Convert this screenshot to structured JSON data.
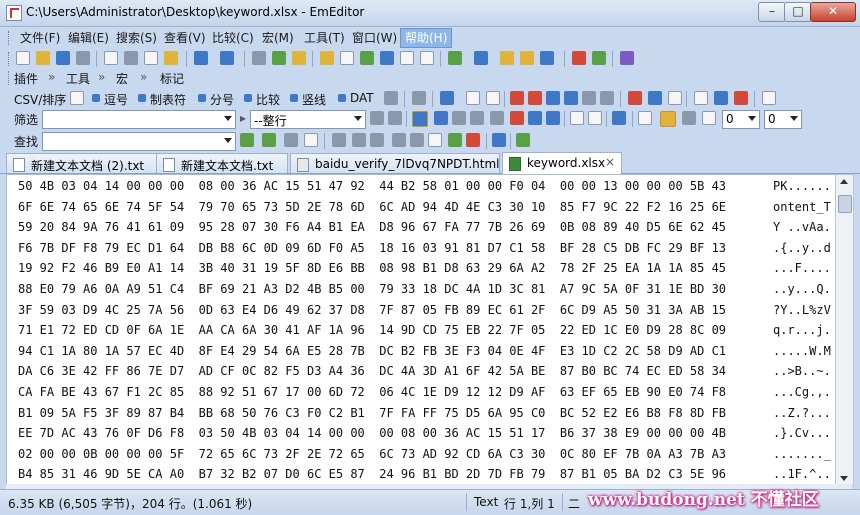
{
  "window": {
    "title": "C:\\Users\\Administrator\\Desktop\\keyword.xlsx - EmEditor"
  },
  "menu": [
    {
      "label": "文件(F)"
    },
    {
      "label": "编辑(E)"
    },
    {
      "label": "搜索(S)"
    },
    {
      "label": "查看(V)"
    },
    {
      "label": "比较(C)"
    },
    {
      "label": "宏(M)"
    },
    {
      "label": "工具(T)"
    },
    {
      "label": "窗口(W)"
    },
    {
      "label": "帮助(H)"
    }
  ],
  "toolbar3": {
    "plugins": "插件",
    "tools": "工具",
    "macro": "宏",
    "markers": "标记"
  },
  "toolbar4": {
    "csv": "CSV/排序",
    "comma": "逗号",
    "tab": "制表符",
    "semicolon": "分号",
    "compare": "比较",
    "pipe": "竖线",
    "dat": "DAT"
  },
  "toolbar5": {
    "filter_label": "筛选",
    "filter_mode": "--整行",
    "combo_a": "0",
    "combo_b": "0"
  },
  "toolbar6": {
    "find_label": "查找"
  },
  "tabs": [
    {
      "label": "新建文本文档 (2).txt"
    },
    {
      "label": "新建文本文档.txt"
    },
    {
      "label": "baidu_verify_7lDvq7NPDT.html"
    },
    {
      "label": "keyword.xlsx",
      "close": "×"
    }
  ],
  "hex_rows": [
    {
      "hex": "50 4B 03 04 14 00 00 00  08 00 36 AC 15 51 47 92  44 B2 58 01 00 00 F0 04  00 00 13 00 00 00 5B 43",
      "ascii": "PK......"
    },
    {
      "hex": "6F 6E 74 65 6E 74 5F 54  79 70 65 73 5D 2E 78 6D  6C AD 94 4D 4E C3 30 10  85 F7 9C 22 F2 16 25 6E",
      "ascii": "ontent_T"
    },
    {
      "hex": "59 20 84 9A 76 41 61 09  95 28 07 30 F6 A4 B1 EA  D8 96 67 FA 77 7B 26 69  0B 08 89 40 D5 6E 62 45",
      "ascii": "Y ..vAa."
    },
    {
      "hex": "F6 7B DF F8 79 EC D1 64  DB B8 6C 0D 09 6D F0 A5  18 16 03 91 81 D7 C1 58  BF 28 C5 DB FC 29 BF 13",
      "ascii": ".{..y..d"
    },
    {
      "hex": "19 92 F2 46 B9 E0 A1 14  3B 40 31 19 5F 8D E6 BB  08 98 B1 D8 63 29 6A A2  78 2F 25 EA 1A 1A 85 45",
      "ascii": "...F...."
    },
    {
      "hex": "88 E0 79 A6 0A A9 51 C4  BF 69 21 A3 D2 4B B5 00  79 33 18 DC 4A 1D 3C 81  A7 9C 5A 0F 31 1E BD 30",
      "ascii": "..y...Q."
    },
    {
      "hex": "3F 59 03 D9 4C 25 7A 56  0D 63 E4 D6 49 62 37 D8  7F 87 05 FB 89 EC 61 2F  6C D9 A5 50 31 3A AB 15",
      "ascii": "?Y..L%zV"
    },
    {
      "hex": "71 E1 72 ED CD 0F 6A 1E  AA CA 6A 30 41 AF 1A 96  14 9D CD 75 EB 22 7F 05  22 ED 1C E0 D9 28 8C 09",
      "ascii": "q.r...j."
    },
    {
      "hex": "94 C1 1A 80 1A 57 EC 4D  8F E4 29 54 6A E5 28 7B  DC B2 FB 3E F3 04 0E 4F  E3 1D C2 2C 58 D9 AD C1",
      "ascii": ".....W.M"
    },
    {
      "hex": "DA C6 3E 42 FF 86 7E D7  AD CF 0C 82 F5 D3 A4 36  DC 4A 3D A1 6F 42 5A BE  87 B0 BC 74 EC ED 58 34",
      "ascii": "..>B..~."
    },
    {
      "hex": "CA FA BE 43 67 F1 2C 85  88 92 51 67 17 00 6D 72  06 4C 1E D9 12 12 D9 AF  63 EF 65 EB 90 E0 74 F8",
      "ascii": "...Cg.,."
    },
    {
      "hex": "B1 09 5A F5 3F 89 87 B4  BB 68 50 76 C3 F0 C2 B1  7F FA FF 75 D5 6A 95 C0  BC 52 E2 E6 B8 F8 8D FB",
      "ascii": "..Z.?..."
    },
    {
      "hex": "EE 7D AC 43 76 0F D6 F8  03 50 4B 03 04 14 00 00  00 08 00 36 AC 15 51 17  B6 37 38 E9 00 00 00 4B",
      "ascii": ".}.Cv..."
    },
    {
      "hex": "02 00 00 0B 00 00 00 5F  72 65 6C 73 2F 2E 72 65  6C 73 AD 92 CD 6A C3 30  0C 80 EF 7B 0A A3 7B A3",
      "ascii": "......._"
    },
    {
      "hex": "B4 85 31 46 9D 5E CA A0  B7 32 B2 07 D0 6C E5 87  24 96 B1 BD 2D 7D FB 79  87 B1 05 BA D2 C3 5E 96",
      "ascii": "..1F.^.."
    }
  ],
  "status": {
    "size": "6.35 KB (6,505 字节)，204 行。(1.061 秒)",
    "mode": "Text",
    "position": "行 1,列 1",
    "extra": "二",
    "watermark": "www.budong.net 不懂社区"
  },
  "colors": {
    "active_menu": "#8fb6e8",
    "watermark": "#d0157c",
    "frame": "#c8d9ef"
  }
}
